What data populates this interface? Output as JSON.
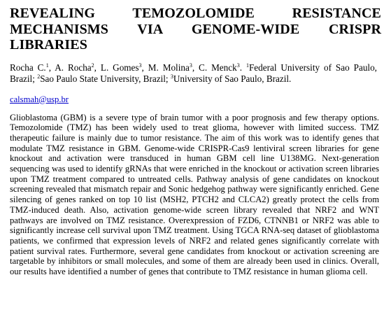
{
  "title_lines": [
    "REVEALING TEMOZOLOMIDE RESISTANCE",
    "MECHANISMS VIA GENOME-WIDE CRISPR",
    "LIBRARIES"
  ],
  "authors": {
    "a1_name": "Rocha C.",
    "a1_sup": "1",
    "a2_name": ", A. Rocha",
    "a2_sup": "2",
    "a3_name": ", L. Gomes",
    "a3_sup": "3",
    "a4_name": ", M. Molina",
    "a4_sup": "3",
    "a5_name": ", C. Menck",
    "a5_sup": "3",
    "aff1_sup": "1",
    "aff1_text": "Federal University of Sao Paulo, Brazil; ",
    "aff2_sup": "2",
    "aff2_text": "Sao Paulo State University, Brazil; ",
    "aff3_sup": "3",
    "aff3_text": "University of Sao Paulo, Brazil."
  },
  "email": "calsmah@usp.br",
  "abstract": "Glioblastoma (GBM) is a severe type of brain tumor with a poor prognosis and few therapy options. Temozolomide (TMZ) has been widely used to treat glioma, however with limited success. TMZ therapeutic failure is mainly due to tumor resistance. The aim of this work was to identify genes that modulate TMZ resistance in GBM. Genome-wide CRISPR-Cas9 lentiviral screen libraries for gene knockout and activation were transduced in human GBM cell line U138MG. Next-generation sequencing was used to identify gRNAs that were enriched in the knockout or activation screen libraries upon TMZ treatment compared to untreated cells. Pathway analysis of gene candidates on knockout screening revealed that mismatch repair and Sonic hedgehog pathway were significantly enriched. Gene silencing of genes ranked on top 10 list (MSH2, PTCH2 and CLCA2) greatly protect the cells from TMZ-induced death. Also, activation genome-wide screen library revealed that NRF2 and WNT pathways are involved on TMZ resistance. Overexpression of FZD6, CTNNB1 or NRF2 was able to significantly increase cell survival upon TMZ treatment. Using TGCA RNA-seq dataset of glioblastoma patients, we confirmed that expression levels of NRF2 and related genes significantly correlate with patient survival rates. Furthermore, several gene candidates from knockout or activation screening are targetable by inhibitors or small molecules, and some of them are already been used in clinics. Overall, our results have identified a number of genes that contribute to TMZ resistance in human glioma cell."
}
